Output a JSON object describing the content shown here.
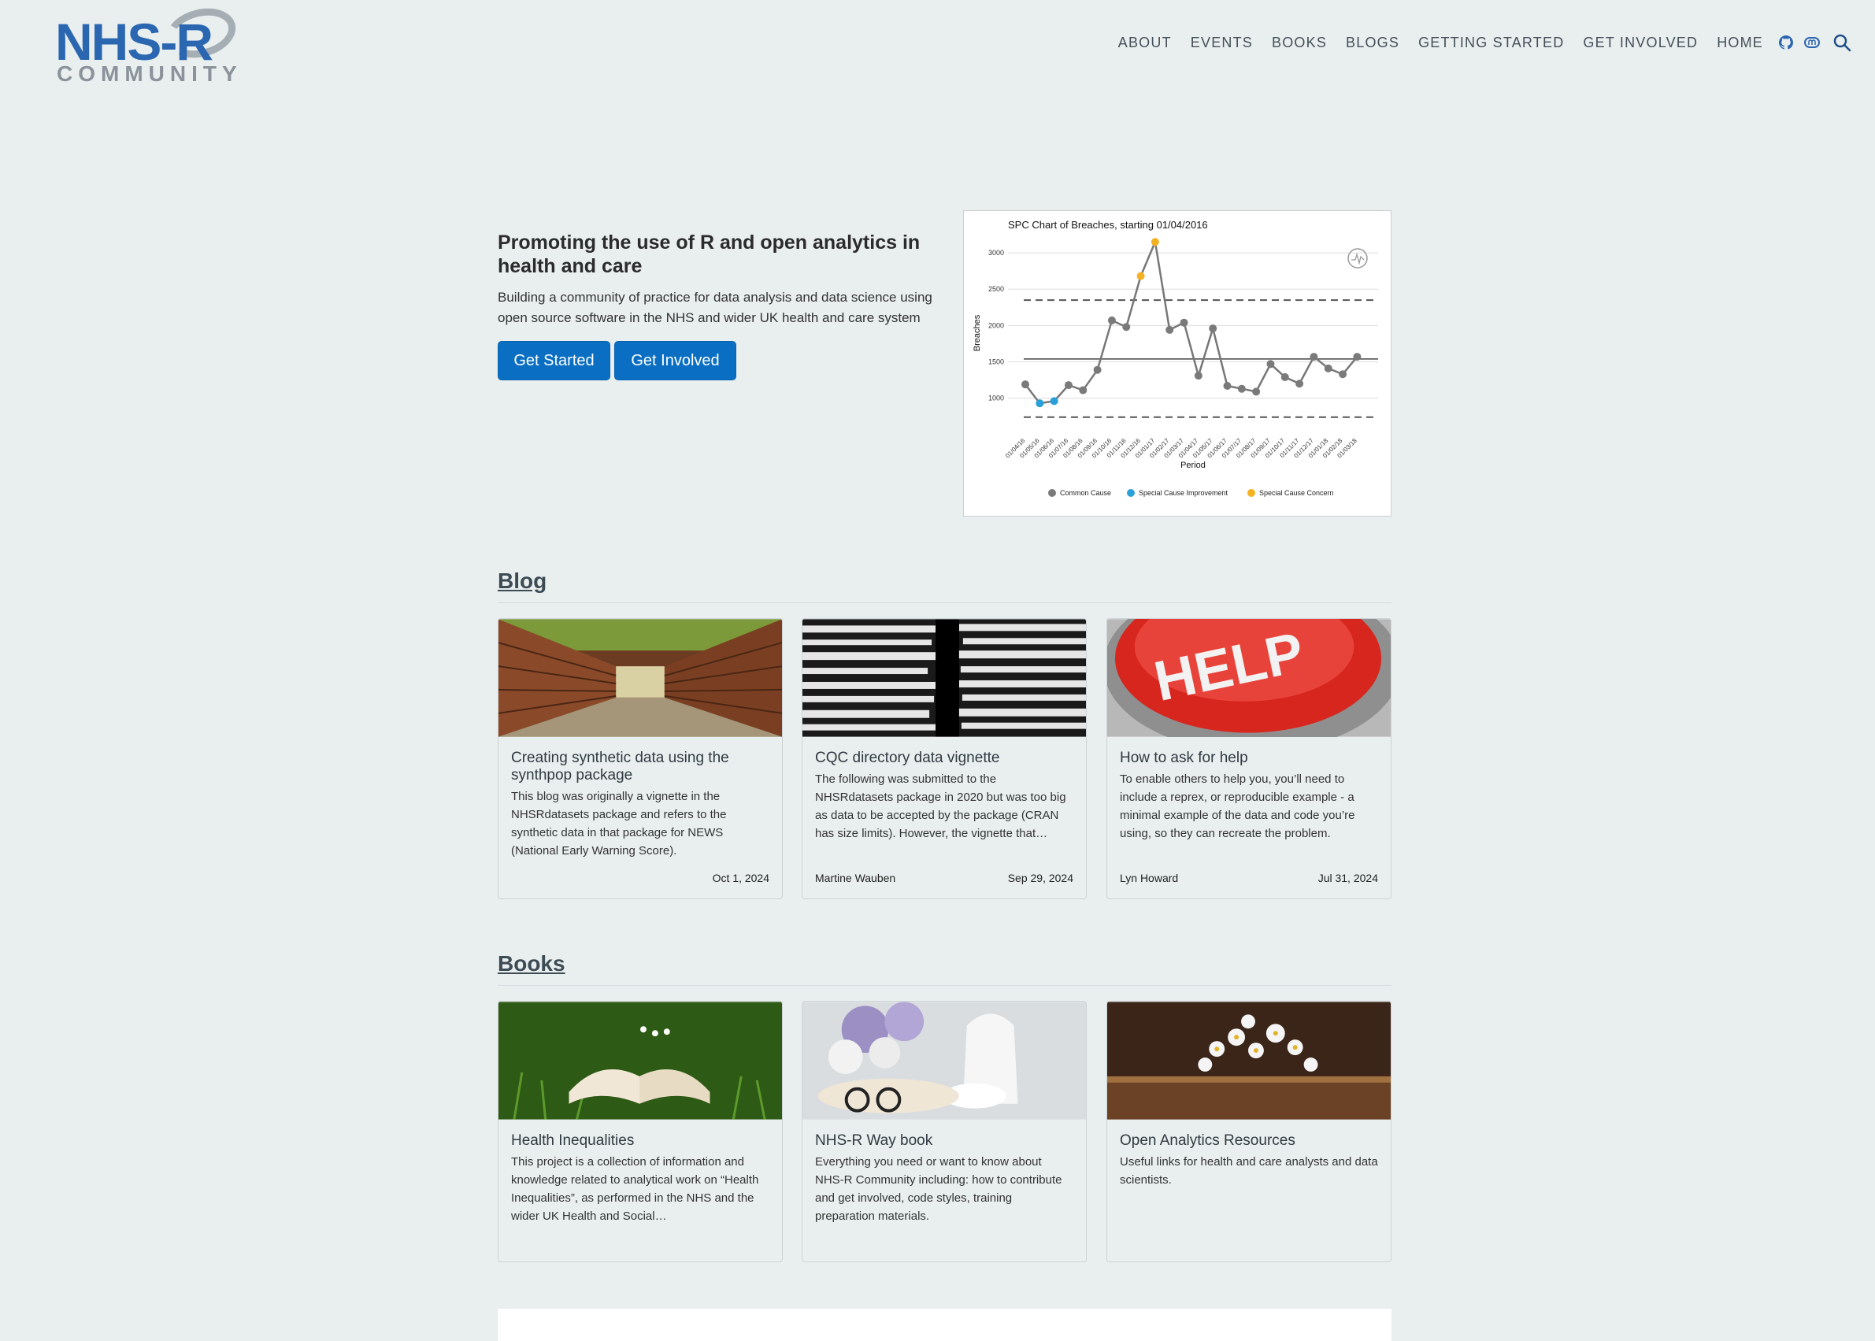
{
  "logo": {
    "main": "NHS-R",
    "sub": "COMMUNITY"
  },
  "nav": {
    "items": [
      "ABOUT",
      "EVENTS",
      "BOOKS",
      "BLOGS",
      "GETTING STARTED",
      "GET INVOLVED",
      "HOME"
    ],
    "icons": [
      "github-icon",
      "mastodon-icon",
      "search-icon"
    ]
  },
  "hero": {
    "title": "Promoting the use of R and open analytics in health and care",
    "subtitle": "Building a community of practice for data analysis and data science using open source software in the NHS and wider UK health and care system",
    "btn_start": "Get Started",
    "btn_involved": "Get Involved"
  },
  "chart_data": {
    "type": "line",
    "title": "SPC Chart of Breaches, starting 01/04/2016",
    "xlabel": "Period",
    "ylabel": "Breaches",
    "x": [
      "01/04/16",
      "01/05/16",
      "01/06/16",
      "01/07/16",
      "01/08/16",
      "01/09/16",
      "01/10/16",
      "01/11/16",
      "01/12/16",
      "01/01/17",
      "01/02/17",
      "01/03/17",
      "01/04/17",
      "01/05/17",
      "01/06/17",
      "01/07/17",
      "01/08/17",
      "01/09/17",
      "01/10/17",
      "01/11/17",
      "01/12/17",
      "01/01/18",
      "01/02/18",
      "01/03/18"
    ],
    "values": [
      1190,
      930,
      960,
      1180,
      1110,
      1390,
      2070,
      1980,
      2680,
      3150,
      1940,
      2040,
      1310,
      1960,
      1170,
      1130,
      1090,
      1470,
      1290,
      1200,
      1570,
      1410,
      1330,
      1570
    ],
    "point_class": [
      "common",
      "improvement",
      "improvement",
      "common",
      "common",
      "common",
      "common",
      "common",
      "concern",
      "concern",
      "common",
      "common",
      "common",
      "common",
      "common",
      "common",
      "common",
      "common",
      "common",
      "common",
      "common",
      "common",
      "common",
      "common"
    ],
    "mean": 1540,
    "ucl": 2350,
    "lcl": 740,
    "yticks": [
      1000,
      1500,
      2000,
      2500,
      3000
    ],
    "ylim": [
      650,
      3250
    ],
    "legend": [
      "Common Cause",
      "Special Cause Improvement",
      "Special Cause Concern"
    ],
    "colors": {
      "common": "#7a7a7a",
      "improvement": "#2aa0d8",
      "concern": "#f4b223"
    }
  },
  "blog": {
    "title": "Blog",
    "cards": [
      {
        "title": "Creating synthetic data using the synthpop package",
        "desc": "This blog was originally a vignette in the NHSRdatasets package and refers to the synthetic data in that package for NEWS (National Early Warning Score).",
        "author": "",
        "date": "Oct 1, 2024"
      },
      {
        "title": "CQC directory data vignette",
        "desc": "The following was submitted to the NHSRdatasets package in 2020 but was too big as data to be accepted by the package (CRAN has size limits). However, the vignette that…",
        "author": "Martine Wauben",
        "date": "Sep 29, 2024"
      },
      {
        "title": "How to ask for help",
        "desc": "To enable others to help you, you’ll need to include a reprex, or reproducible example - a minimal example of the data and code you’re using, so they can recreate the problem.",
        "author": "Lyn Howard",
        "date": "Jul 31, 2024"
      }
    ]
  },
  "books": {
    "title": "Books",
    "cards": [
      {
        "title": "Health Inequalities",
        "desc": "This project is a collection of information and knowledge related to analytical work on “Health Inequalities”, as performed in the NHS and the wider UK Health and Social…"
      },
      {
        "title": "NHS-R Way book",
        "desc": "Everything you need or want to know about NHS-R Community including: how to contribute and get involved, code styles, training preparation materials."
      },
      {
        "title": "Open Analytics Resources",
        "desc": "Useful links for health and care analysts and data scientists."
      }
    ]
  },
  "help_image_text": "HELP"
}
